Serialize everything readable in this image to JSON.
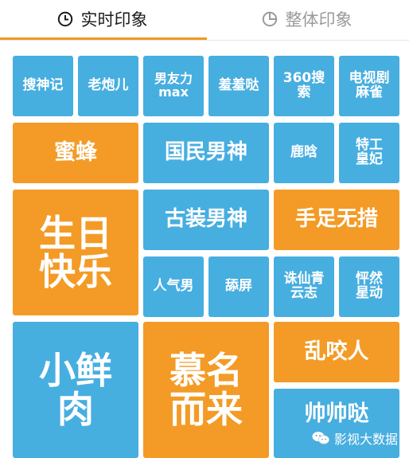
{
  "tabs": {
    "realtime": {
      "label": "实时印象",
      "icon": "clock-icon"
    },
    "overall": {
      "label": "整体印象",
      "icon": "pie-chart-icon"
    }
  },
  "colors": {
    "accent": "#f19a22",
    "blue": "#47aee0",
    "orange": "#f39b26"
  },
  "tiles": {
    "soushenji": "搜神记",
    "laopaoer": "老炮儿",
    "nanyouli": "男友力\nmax",
    "xiuxiuda": "羞羞哒",
    "sou360": "360搜\n索",
    "dianshiju": "电视剧\n麻雀",
    "mifeng": "蜜蜂",
    "guominnanshen": "国民男神",
    "luhan": "鹿晗",
    "tegong": "特工\n皇妃",
    "shengri": "生日\n快乐",
    "guzhuang": "古装男神",
    "shouzu": "手足无措",
    "renqinan": "人气男",
    "tianping": "舔屏",
    "zhuxian": "诛仙青\n云志",
    "pengran": "怦然\n星动",
    "xiaoxianrou": "小鲜\n肉",
    "muming": "慕名\n而来",
    "luanyao": "乱咬人",
    "shuaishuai": "帅帅哒"
  },
  "watermark": {
    "text": "影视大数据",
    "icon": "wechat-icon"
  }
}
